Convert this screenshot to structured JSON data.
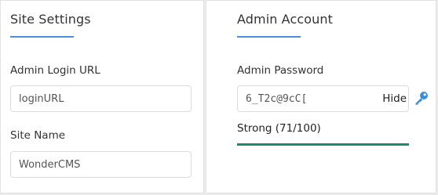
{
  "site_settings": {
    "title": "Site Settings",
    "admin_login_url": {
      "label": "Admin Login URL",
      "value": "loginURL"
    },
    "site_name": {
      "label": "Site Name",
      "value": "WonderCMS"
    }
  },
  "admin_account": {
    "title": "Admin Account",
    "password": {
      "label": "Admin Password",
      "value": "6_T2c@9cC[",
      "toggle_label": "Hide",
      "generate_icon": "key-icon"
    },
    "strength": {
      "text": "Strong (71/100)",
      "score": 71,
      "max": 100,
      "fill_fraction": 1.0,
      "color": "#1a8a72"
    }
  },
  "colors": {
    "accent": "#4a90e2",
    "key_icon": "#3b8fd8"
  }
}
